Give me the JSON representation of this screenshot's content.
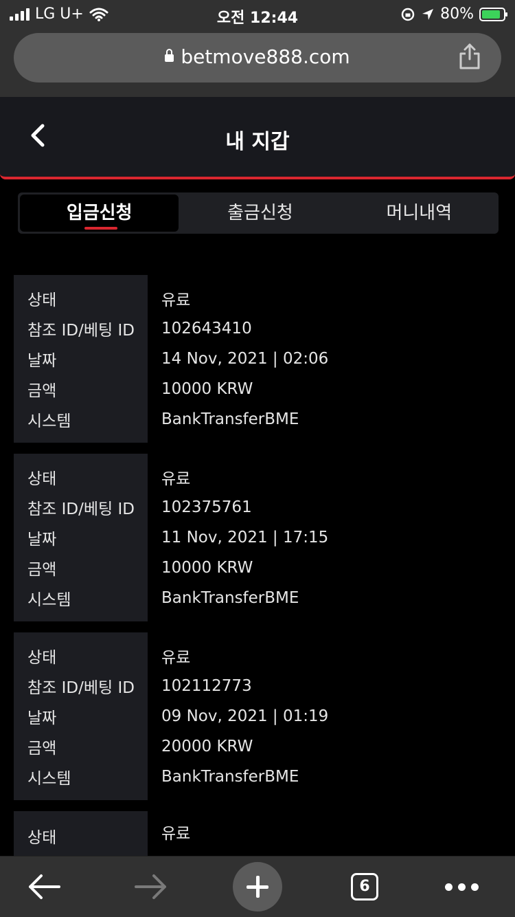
{
  "status_bar": {
    "carrier": "LG U+",
    "time": "오전 12:44",
    "battery": "80%"
  },
  "browser": {
    "url": "betmove888.com"
  },
  "header": {
    "title": "내 지갑"
  },
  "tabs": [
    {
      "label": "입금신청",
      "active": true
    },
    {
      "label": "출금신청",
      "active": false
    },
    {
      "label": "머니내역",
      "active": false
    }
  ],
  "records": [
    {
      "status_label": "상태",
      "status": "유료",
      "ref_label": "참조 ID/베팅 ID",
      "ref": "102643410",
      "date_label": "날짜",
      "date": "14 Nov, 2021 | 02:06",
      "amount_label": "금액",
      "amount": "10000 KRW",
      "system_label": "시스템",
      "system": "BankTransferBME"
    },
    {
      "status_label": "상태",
      "status": "유료",
      "ref_label": "참조 ID/베팅 ID",
      "ref": "102375761",
      "date_label": "날짜",
      "date": "11 Nov, 2021 | 17:15",
      "amount_label": "금액",
      "amount": "10000 KRW",
      "system_label": "시스템",
      "system": "BankTransferBME"
    },
    {
      "status_label": "상태",
      "status": "유료",
      "ref_label": "참조 ID/베팅 ID",
      "ref": "102112773",
      "date_label": "날짜",
      "date": "09 Nov, 2021 | 01:19",
      "amount_label": "금액",
      "amount": "20000 KRW",
      "system_label": "시스템",
      "system": "BankTransferBME"
    },
    {
      "status_label": "상태",
      "status": "유료"
    }
  ],
  "toolbar": {
    "tab_count": "6"
  }
}
